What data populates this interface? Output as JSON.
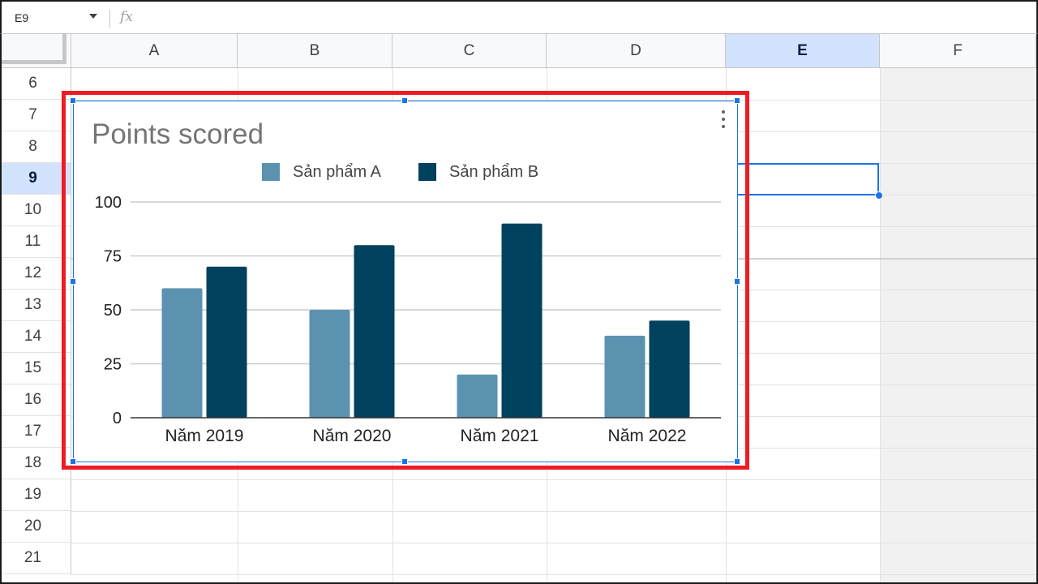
{
  "formula_bar": {
    "name_box": "E9",
    "fx_label": "fx",
    "value": ""
  },
  "columns": [
    "A",
    "B",
    "C",
    "D",
    "E",
    "F"
  ],
  "selected_column": "E",
  "rows": [
    "6",
    "7",
    "8",
    "9",
    "10",
    "11",
    "12",
    "13",
    "14",
    "15",
    "16",
    "17",
    "18",
    "19",
    "20",
    "21"
  ],
  "selected_row": "9",
  "colors": {
    "accent": "#1a73e8",
    "highlight": "#ee1c25",
    "series_a": "#5b92b0",
    "series_b": "#00425d"
  },
  "chart_data": {
    "type": "bar",
    "title": "Points scored",
    "categories": [
      "Năm 2019",
      "Năm 2020",
      "Năm 2021",
      "Năm 2022"
    ],
    "series": [
      {
        "name": "Sản phẩm A",
        "values": [
          60,
          50,
          20,
          38
        ]
      },
      {
        "name": "Sản phẩm B",
        "values": [
          70,
          80,
          90,
          45
        ]
      }
    ],
    "ylim": [
      0,
      100
    ],
    "yticks": [
      0,
      25,
      50,
      75,
      100
    ],
    "xlabel": "",
    "ylabel": "",
    "legend": "top",
    "grid": true
  }
}
